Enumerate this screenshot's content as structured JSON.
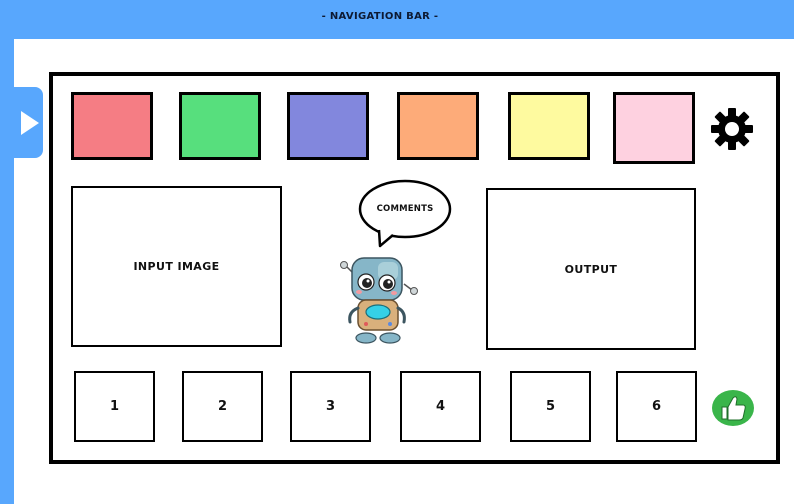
{
  "navbar": {
    "title": "- NAVIGATION BAR -"
  },
  "side_toggle": {
    "icon": "play-triangle-icon"
  },
  "swatches": [
    {
      "color": "#f57d84"
    },
    {
      "color": "#57df7d"
    },
    {
      "color": "#8287dd"
    },
    {
      "color": "#fdab79"
    },
    {
      "color": "#fefa9f"
    },
    {
      "color": "#fed1e0"
    }
  ],
  "settings": {
    "icon": "gear-icon"
  },
  "input_panel": {
    "label": "INPUT IMAGE"
  },
  "output_panel": {
    "label": "OUTPUT"
  },
  "comment_bubble": {
    "label": "COMMENTS"
  },
  "mascot": {
    "icon": "robot-icon"
  },
  "number_buttons": [
    "1",
    "2",
    "3",
    "4",
    "5",
    "6"
  ],
  "like": {
    "icon": "thumbs-up-icon",
    "color": "#3ab54a"
  }
}
